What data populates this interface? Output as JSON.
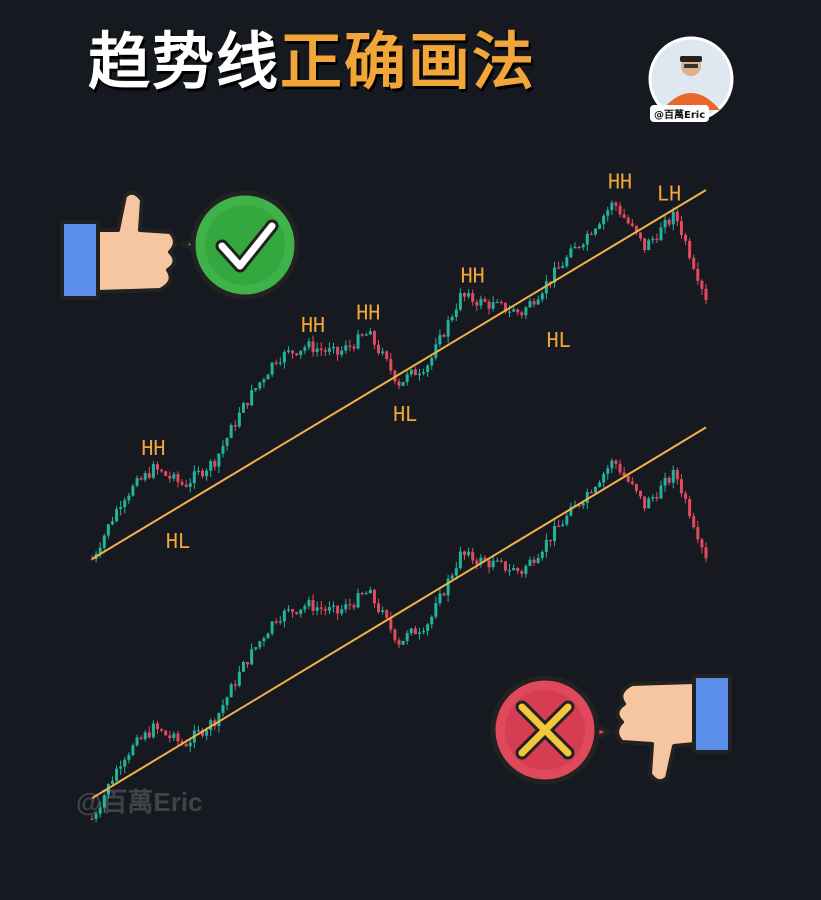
{
  "header": {
    "title_white": "趋势线",
    "title_gold": "正确画法",
    "handle": "@百萬Eric"
  },
  "watermark": "@百萬Eric",
  "colors": {
    "background": "#161920",
    "up": "#21b39b",
    "down": "#e24a5e",
    "trendline": "#f2b14a",
    "label": "#f2a63a"
  },
  "icons": {
    "good": [
      "thumbs-up-icon",
      "check-badge-icon"
    ],
    "bad": [
      "thumbs-down-icon",
      "cross-badge-icon"
    ]
  },
  "chart_data": [
    {
      "type": "line",
      "style": "candlestick price path",
      "x": [
        0,
        5,
        10,
        15,
        20,
        25,
        30,
        35,
        40,
        45,
        50,
        55,
        60,
        65,
        70,
        75,
        80,
        85,
        90,
        95,
        100
      ],
      "series": [
        {
          "values": [
            10,
            25,
            32,
            28,
            34,
            48,
            59,
            62,
            60,
            65,
            53,
            58,
            74,
            72,
            70,
            79,
            88,
            97,
            86,
            94,
            74
          ]
        }
      ],
      "annotations": [
        {
          "text": "HH",
          "x": 10,
          "y": 32
        },
        {
          "text": "HL",
          "x": 14,
          "y": 21
        },
        {
          "text": "HH",
          "x": 36,
          "y": 62
        },
        {
          "text": "HH",
          "x": 45,
          "y": 65
        },
        {
          "text": "HL",
          "x": 51,
          "y": 52
        },
        {
          "text": "HH",
          "x": 62,
          "y": 74
        },
        {
          "text": "HL",
          "x": 76,
          "y": 70
        },
        {
          "text": "HH",
          "x": 86,
          "y": 97
        },
        {
          "text": "LH",
          "x": 94,
          "y": 94
        }
      ],
      "trendline": [
        [
          0,
          10
        ],
        [
          100,
          100
        ]
      ]
    },
    {
      "type": "line",
      "style": "candlestick price path",
      "x": [
        0,
        5,
        10,
        15,
        20,
        25,
        30,
        35,
        40,
        45,
        50,
        55,
        60,
        65,
        70,
        75,
        80,
        85,
        90,
        95,
        100
      ],
      "series": [
        {
          "values": [
            10,
            25,
            32,
            28,
            34,
            48,
            59,
            62,
            60,
            65,
            53,
            58,
            74,
            72,
            70,
            79,
            88,
            97,
            86,
            94,
            74
          ]
        }
      ],
      "annotations": [],
      "trendline": [
        [
          0,
          15
        ],
        [
          100,
          105
        ]
      ]
    }
  ]
}
